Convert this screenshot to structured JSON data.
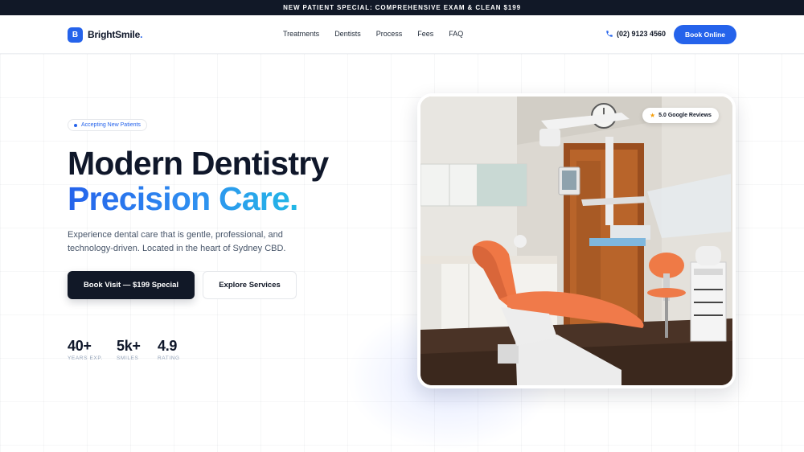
{
  "banner": {
    "text": "NEW PATIENT SPECIAL: COMPREHENSIVE EXAM & CLEAN $199"
  },
  "brand": {
    "mark": "B",
    "name": "BrightSmile",
    "dot": "."
  },
  "nav": {
    "links": [
      "Treatments",
      "Dentists",
      "Process",
      "Fees",
      "FAQ"
    ],
    "phone": "(02) 9123 4560",
    "book_label": "Book Online"
  },
  "hero": {
    "badge": "Accepting New Patients",
    "title_line1": "Modern Dentistry",
    "title_line2": "Precision Care.",
    "lede": "Experience dental care that is gentle, professional, and technology-driven. Located in the heart of Sydney CBD.",
    "cta_primary": "Book Visit — $199 Special",
    "cta_secondary": "Explore Services",
    "stats": [
      {
        "value": "40+",
        "label": "YEARS EXP."
      },
      {
        "value": "5k+",
        "label": "SMILES"
      },
      {
        "value": "4.9",
        "label": "RATING"
      }
    ],
    "review_badge": "5.0 Google Reviews"
  },
  "colors": {
    "accent": "#2563eb",
    "dark": "#111827",
    "chair": "#f07a4a"
  }
}
